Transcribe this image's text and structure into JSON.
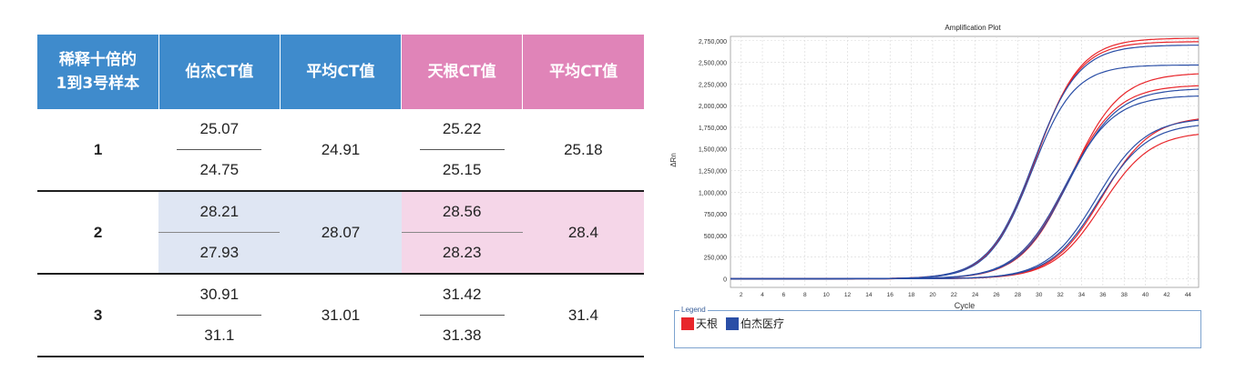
{
  "table": {
    "headers": [
      {
        "line1": "稀释十倍的",
        "line2": "1到3号样本",
        "tone": "blue"
      },
      {
        "line1": "伯杰CT值",
        "line2": "",
        "tone": "blue"
      },
      {
        "line1": "平均CT值",
        "line2": "",
        "tone": "blue"
      },
      {
        "line1": "天根CT值",
        "line2": "",
        "tone": "pink"
      },
      {
        "line1": "平均CT值",
        "line2": "",
        "tone": "pink"
      }
    ],
    "rows": [
      {
        "sample": "1",
        "bojie": [
          "25.07",
          "24.75"
        ],
        "bojie_avg": "24.91",
        "tiangen": [
          "25.22",
          "25.15"
        ],
        "tiangen_avg": "25.18"
      },
      {
        "sample": "2",
        "bojie": [
          "28.21",
          "27.93"
        ],
        "bojie_avg": "28.07",
        "tiangen": [
          "28.56",
          "28.23"
        ],
        "tiangen_avg": "28.4"
      },
      {
        "sample": "3",
        "bojie": [
          "30.91",
          "31.1"
        ],
        "bojie_avg": "31.01",
        "tiangen": [
          "31.42",
          "31.38"
        ],
        "tiangen_avg": "31.4"
      }
    ],
    "colors": {
      "blue": "#3f8bcc",
      "pink": "#e084b8",
      "blue_shade": "#dfe6f3",
      "pink_shade": "#f5d6e8"
    }
  },
  "chart_data": {
    "type": "line",
    "title": "Amplification Plot",
    "xlabel": "Cycle",
    "ylabel": "ΔRn",
    "xlim": [
      1,
      45
    ],
    "ylim": [
      -100000,
      2800000
    ],
    "xticks": [
      2,
      4,
      6,
      8,
      10,
      12,
      14,
      16,
      18,
      20,
      22,
      24,
      26,
      28,
      30,
      32,
      34,
      36,
      38,
      40,
      42,
      44
    ],
    "yticks": [
      0,
      250000,
      500000,
      750000,
      1000000,
      1250000,
      1500000,
      1750000,
      2000000,
      2250000,
      2500000,
      2750000
    ],
    "ytick_labels": [
      "0",
      "250,000",
      "500,000",
      "750,000",
      "1,000,000",
      "1,250,000",
      "1,500,000",
      "1,750,000",
      "2,000,000",
      "2,250,000",
      "2,500,000",
      "2,750,000"
    ],
    "grid": true,
    "legend": {
      "title": "Legend",
      "position": "bottom"
    },
    "series": [
      {
        "name": "天根",
        "color": "#e8262b",
        "curves": [
          {
            "ct": 25.2,
            "plateau": 2780000,
            "slope": 2.1
          },
          {
            "ct": 25.1,
            "plateau": 2740000,
            "slope": 2.1
          },
          {
            "ct": 28.5,
            "plateau": 2380000,
            "slope": 2.3
          },
          {
            "ct": 28.2,
            "plateau": 2240000,
            "slope": 2.3
          },
          {
            "ct": 31.4,
            "plateau": 1880000,
            "slope": 2.3
          },
          {
            "ct": 31.4,
            "plateau": 1700000,
            "slope": 2.3
          }
        ]
      },
      {
        "name": "伯杰医疗",
        "color": "#2a4ea6",
        "curves": [
          {
            "ct": 25.0,
            "plateau": 2700000,
            "slope": 2.1
          },
          {
            "ct": 24.8,
            "plateau": 2470000,
            "slope": 2.0
          },
          {
            "ct": 28.2,
            "plateau": 2200000,
            "slope": 2.3
          },
          {
            "ct": 27.9,
            "plateau": 2120000,
            "slope": 2.3
          },
          {
            "ct": 30.9,
            "plateau": 1860000,
            "slope": 2.3
          },
          {
            "ct": 31.1,
            "plateau": 1800000,
            "slope": 2.3
          }
        ]
      }
    ]
  }
}
